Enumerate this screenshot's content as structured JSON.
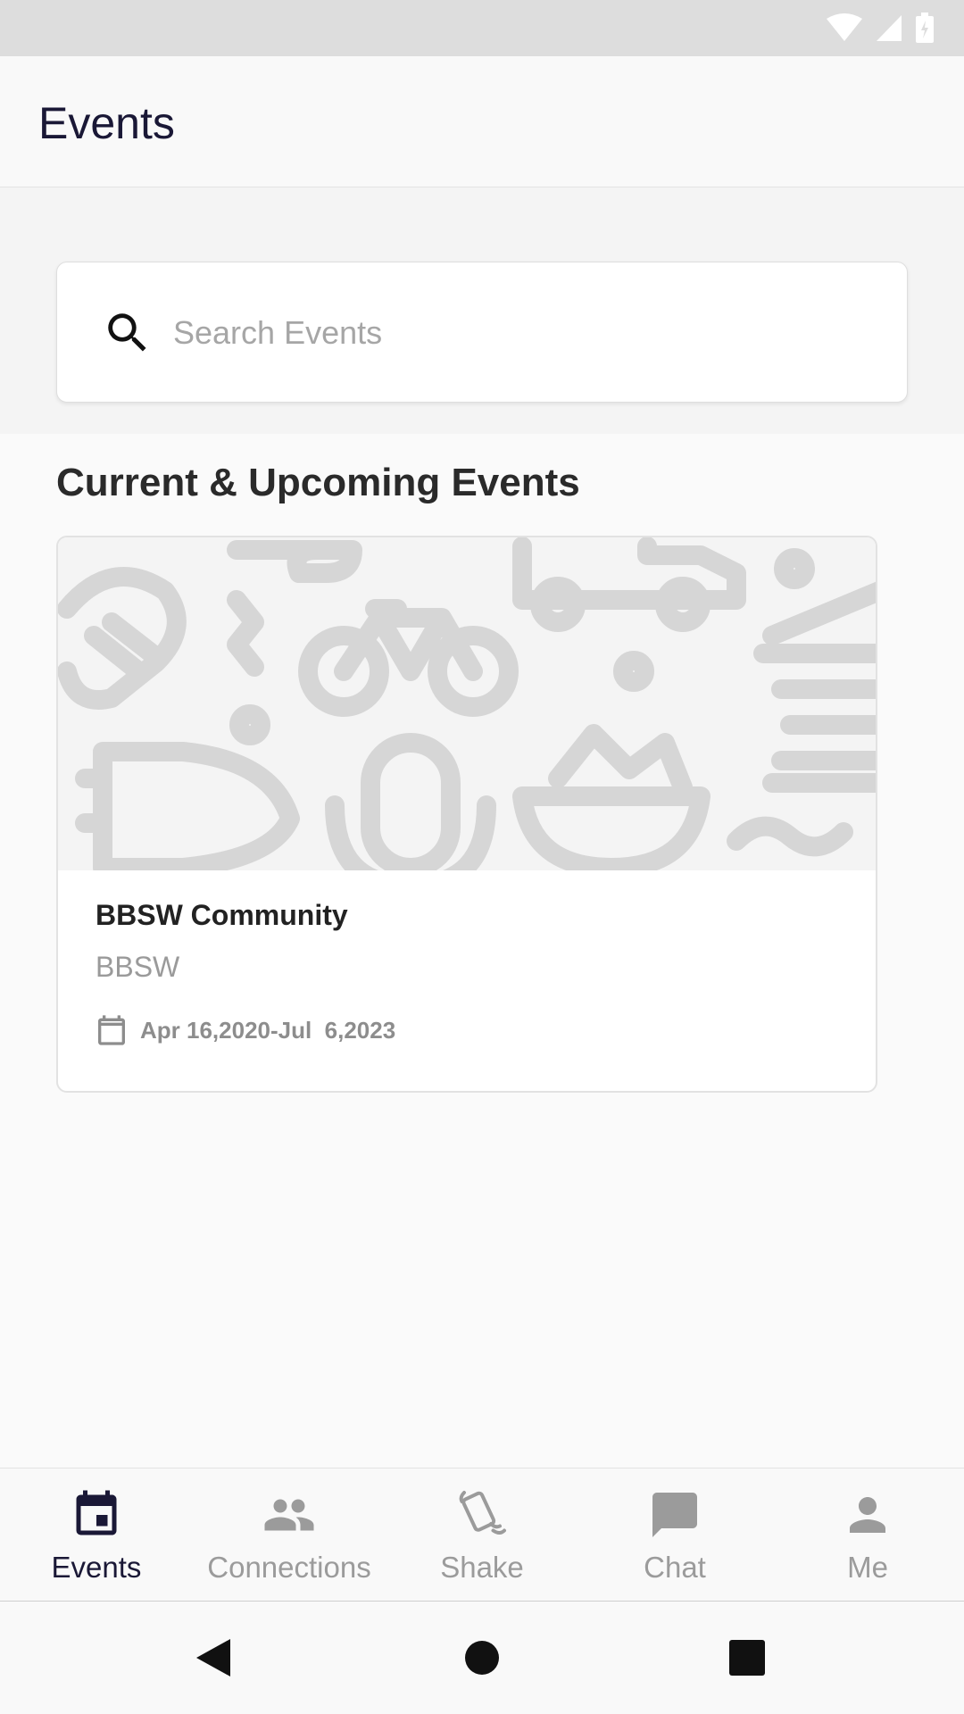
{
  "app": {
    "title": "Events"
  },
  "search": {
    "placeholder": "Search Events",
    "value": ""
  },
  "section": {
    "title": "Current & Upcoming Events"
  },
  "events": [
    {
      "name": "BBSW Community",
      "organizer": "BBSW",
      "date_range": "Apr 16,2020-Jul  6,2023",
      "icon": "calendar-icon"
    }
  ],
  "bottom_nav": {
    "items": [
      {
        "label": "Events",
        "icon": "event-calendar-icon",
        "active": true
      },
      {
        "label": "Connections",
        "icon": "people-icon",
        "active": false
      },
      {
        "label": "Shake",
        "icon": "shake-phone-icon",
        "active": false
      },
      {
        "label": "Chat",
        "icon": "chat-bubble-icon",
        "active": false
      },
      {
        "label": "Me",
        "icon": "person-icon",
        "active": false
      }
    ]
  },
  "colors": {
    "primary": "#1a1836",
    "inactive": "#9b9b9b",
    "status_bar": "#dddddd",
    "background": "#fafafa"
  }
}
